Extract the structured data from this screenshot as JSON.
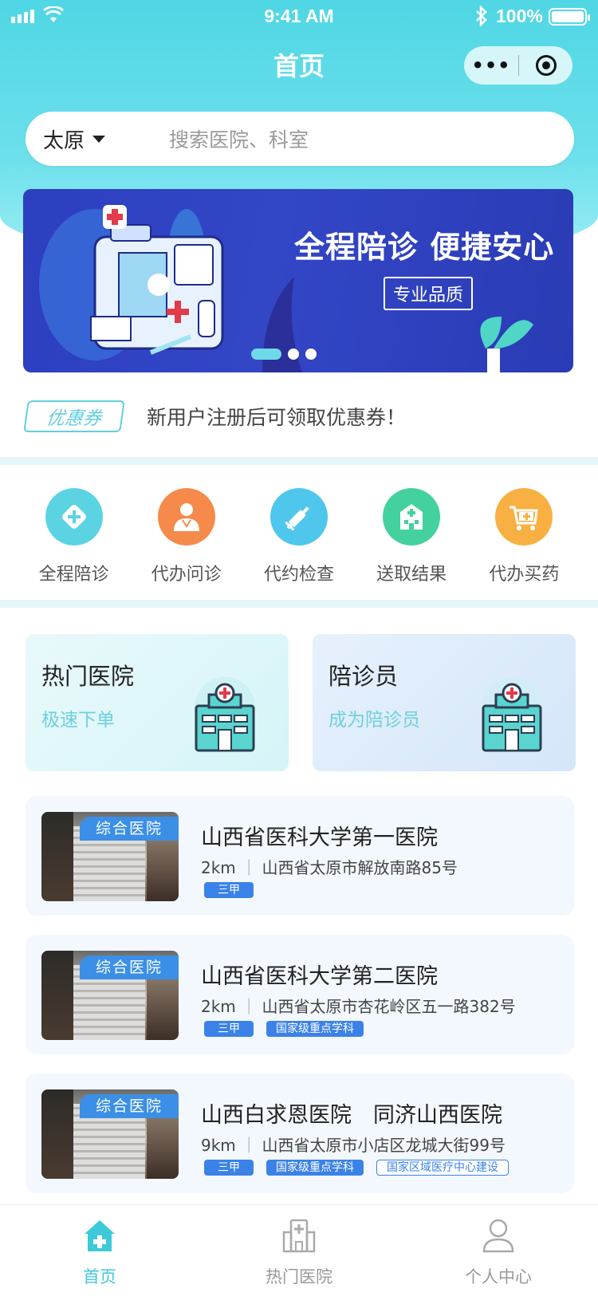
{
  "status_bar": {
    "time": "9:41 AM",
    "battery": "100%"
  },
  "nav": {
    "title": "首页",
    "menu_icon": "more-dots-icon",
    "close_icon": "target-icon"
  },
  "search": {
    "city": "太原",
    "placeholder": "搜索医院、科室"
  },
  "banner": {
    "headline": "全程陪诊 便捷安心",
    "badge": "专业品质",
    "slides": 3,
    "active_slide": 1
  },
  "coupon": {
    "tag": "优惠券",
    "text": "新用户注册后可领取优惠券！"
  },
  "services": [
    {
      "label": "全程陪诊",
      "icon": "plus-diamond-icon",
      "color": "#5bd3e3"
    },
    {
      "label": "代办问诊",
      "icon": "doctor-icon",
      "color": "#f58a4a"
    },
    {
      "label": "代约检查",
      "icon": "syringe-icon",
      "color": "#4fc6ec"
    },
    {
      "label": "送取结果",
      "icon": "hospital-building-icon",
      "color": "#43d19d"
    },
    {
      "label": "代办买药",
      "icon": "cart-icon",
      "color": "#f8b042"
    }
  ],
  "cards": [
    {
      "title": "热门医院",
      "subtitle": "极速下单",
      "icon": "hospital-icon"
    },
    {
      "title": "陪诊员",
      "subtitle": "成为陪诊员",
      "icon": "hospital-icon"
    }
  ],
  "hospitals": [
    {
      "ribbon": "综合医院",
      "name": "山西省医科大学第一医院",
      "distance": "2km",
      "address": "山西省太原市解放南路85号",
      "tags": [
        "三甲"
      ],
      "outline_tags": []
    },
    {
      "ribbon": "综合医院",
      "name": "山西省医科大学第二医院",
      "distance": "2km",
      "address": "山西省太原市杏花岭区五一路382号",
      "tags": [
        "三甲",
        "国家级重点学科"
      ],
      "outline_tags": []
    },
    {
      "ribbon": "综合医院",
      "name": "山西白求恩医院　同济山西医院",
      "distance": "9km",
      "address": "山西省太原市小店区龙城大街99号",
      "tags": [
        "三甲",
        "国家级重点学科"
      ],
      "outline_tags": [
        "国家区域医疗中心建设"
      ]
    }
  ],
  "tabbar": [
    {
      "label": "首页",
      "icon": "home-icon",
      "active": true
    },
    {
      "label": "热门医院",
      "icon": "hospital-icon",
      "active": false
    },
    {
      "label": "个人中心",
      "icon": "user-icon",
      "active": false
    }
  ],
  "colors": {
    "accent": "#3ec9d9",
    "tag_blue": "#3b82e8",
    "banner": "#2f42c2"
  }
}
